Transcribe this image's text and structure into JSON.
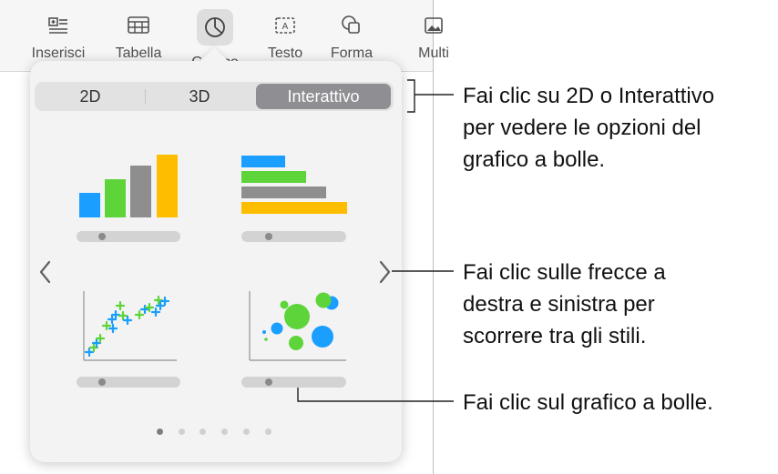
{
  "toolbar": {
    "items": [
      {
        "label": "Inserisci",
        "icon": "insert-icon"
      },
      {
        "label": "Tabella",
        "icon": "table-icon"
      },
      {
        "label": "Grafico",
        "icon": "chart-icon"
      },
      {
        "label": "Testo",
        "icon": "text-icon"
      },
      {
        "label": "Forma",
        "icon": "shape-icon"
      },
      {
        "label": "Multi",
        "icon": "media-icon"
      }
    ]
  },
  "popover": {
    "tabs": [
      "2D",
      "3D",
      "Interattivo"
    ],
    "selected_tab": "Interattivo",
    "chart_styles": [
      "column",
      "bar",
      "scatter",
      "bubble"
    ],
    "page_count": 6,
    "current_page": 1,
    "colors": {
      "blue": "#1a9eff",
      "green": "#5dd43a",
      "gray": "#8e8e8e",
      "yellow": "#ffbd00"
    }
  },
  "callouts": {
    "tabs": "Fai clic su 2D o Interattivo\nper vedere le opzioni del\ngrafico a bolle.",
    "arrows": "Fai clic sulle frecce a\ndestra e sinistra per\nscorrere tra gli stili.",
    "bubble": "Fai clic sul grafico a bolle."
  }
}
